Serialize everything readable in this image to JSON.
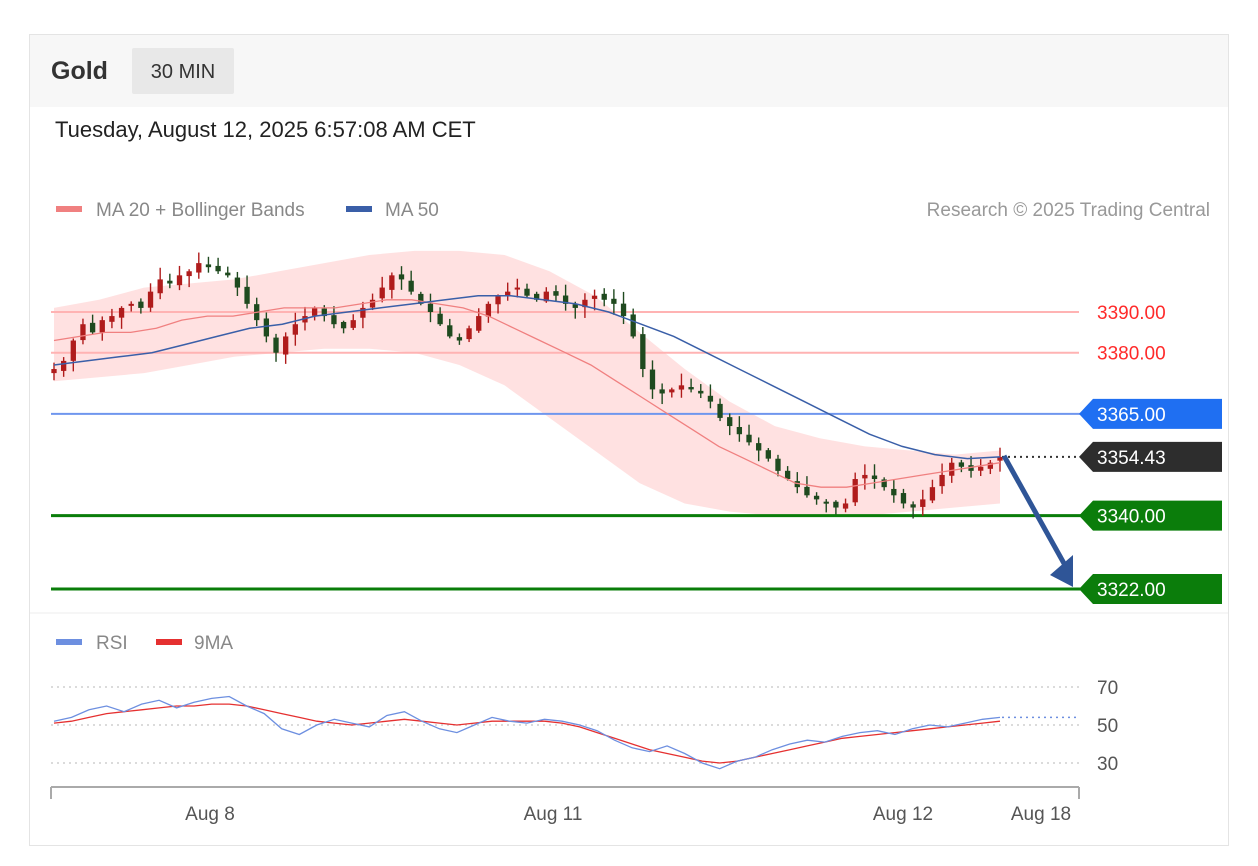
{
  "header": {
    "instrument": "Gold",
    "timeframe": "30 MIN"
  },
  "datetime": "Tuesday, August 12, 2025 6:57:08 AM CET",
  "legend": {
    "ma20": "MA 20 + Bollinger Bands",
    "ma50": "MA 50",
    "rsi": "RSI",
    "rsi_ma": "9MA"
  },
  "credit": "Research © 2025 Trading Central",
  "colors": {
    "resistance": "#ff2a2a",
    "pivot": "#2e6fe8",
    "support": "#0a7d0a",
    "last": "#333333",
    "ma20": "#f08080",
    "ma50": "#3a5fa8",
    "bands": "#ffdcdc",
    "up": "#b01c1c",
    "down": "#1f4a1f",
    "rsi": "#6d8fe0",
    "rsi_ma": "#e53030"
  },
  "chart_data": [
    {
      "type": "candlestick",
      "title": "Gold 30 MIN",
      "x_ticks": [
        "Aug 8",
        "Aug 11",
        "Aug 12",
        "Aug 18"
      ],
      "ylim": [
        3318,
        3413
      ],
      "levels": [
        {
          "label": "3390.00",
          "value": 3390.0,
          "kind": "resistance"
        },
        {
          "label": "3380.00",
          "value": 3380.0,
          "kind": "resistance"
        },
        {
          "label": "3365.00",
          "value": 3365.0,
          "kind": "pivot"
        },
        {
          "label": "3354.43",
          "value": 3354.43,
          "kind": "last"
        },
        {
          "label": "3340.00",
          "value": 3340.0,
          "kind": "support"
        },
        {
          "label": "3322.00",
          "value": 3322.0,
          "kind": "support"
        }
      ],
      "forecast": {
        "from": 3354.43,
        "to": 3322.0,
        "direction": "down"
      },
      "close_path": [
        3376,
        3378,
        3383,
        3387,
        3385,
        3388,
        3389,
        3391,
        3392,
        3391,
        3395,
        3398,
        3397,
        3399,
        3400,
        3402,
        3401,
        3400,
        3399,
        3396,
        3392,
        3388,
        3384,
        3380,
        3384,
        3387,
        3389,
        3391,
        3389,
        3387,
        3386,
        3388,
        3391,
        3393,
        3396,
        3399,
        3398,
        3395,
        3392,
        3390,
        3387,
        3384,
        3383,
        3386,
        3389,
        3392,
        3394,
        3395,
        3396,
        3394,
        3393,
        3395,
        3394,
        3392,
        3391,
        3393,
        3394,
        3393,
        3392,
        3389,
        3384,
        3376,
        3371,
        3370,
        3371,
        3372,
        3371,
        3370,
        3368,
        3364,
        3362,
        3360,
        3358,
        3356,
        3354,
        3351,
        3349,
        3347,
        3345,
        3344,
        3343,
        3342,
        3343,
        3349,
        3350,
        3349,
        3347,
        3345,
        3343,
        3342,
        3344,
        3347,
        3350,
        3353,
        3352,
        3351,
        3352,
        3353,
        3354.43
      ],
      "ma20": [
        3383,
        3384,
        3385,
        3385,
        3386,
        3388,
        3389,
        3389,
        3390,
        3391,
        3391,
        3391,
        3392,
        3393,
        3393,
        3392,
        3391,
        3389,
        3386,
        3383,
        3380,
        3377,
        3373,
        3369,
        3365,
        3361,
        3357,
        3354,
        3351,
        3348,
        3347,
        3347,
        3348,
        3349,
        3350,
        3351,
        3352,
        3353
      ],
      "ma50": [
        3377,
        3378,
        3379,
        3380,
        3382,
        3384,
        3386,
        3387,
        3389,
        3390,
        3391,
        3392,
        3393,
        3394,
        3394,
        3393,
        3392,
        3390,
        3387,
        3384,
        3380,
        3376,
        3372,
        3368,
        3364,
        3360,
        3357,
        3355,
        3354,
        3354.43
      ],
      "bands_upper": [
        3391,
        3393,
        3396,
        3397,
        3398,
        3400,
        3402,
        3404,
        3405,
        3405,
        3404,
        3400,
        3394,
        3385,
        3376,
        3368,
        3362,
        3359,
        3357,
        3356,
        3355,
        3356
      ],
      "bands_lower": [
        3373,
        3374,
        3375,
        3377,
        3379,
        3380,
        3381,
        3381,
        3380,
        3377,
        3372,
        3364,
        3356,
        3348,
        3343,
        3341,
        3340,
        3340,
        3340,
        3341,
        3342,
        3343
      ]
    },
    {
      "type": "line",
      "title": "RSI",
      "yticks": [
        "70",
        "50",
        "30"
      ],
      "ylim": [
        20,
        80
      ],
      "series": [
        {
          "name": "RSI",
          "values": [
            52,
            54,
            58,
            60,
            57,
            61,
            63,
            59,
            62,
            64,
            65,
            60,
            56,
            48,
            45,
            50,
            53,
            51,
            49,
            55,
            57,
            52,
            48,
            46,
            50,
            54,
            52,
            51,
            53,
            52,
            50,
            47,
            42,
            38,
            36,
            39,
            35,
            30,
            27,
            31,
            33,
            37,
            40,
            42,
            41,
            44,
            46,
            47,
            45,
            48,
            50,
            49,
            51,
            53,
            54
          ]
        },
        {
          "name": "9MA",
          "values": [
            51,
            52,
            54,
            56,
            57,
            58,
            59,
            60,
            60,
            61,
            61,
            60,
            58,
            56,
            54,
            52,
            51,
            50,
            51,
            52,
            53,
            52,
            51,
            50,
            51,
            52,
            52,
            52,
            52,
            51,
            49,
            46,
            43,
            40,
            37,
            35,
            33,
            31,
            30,
            31,
            33,
            35,
            37,
            39,
            41,
            43,
            44,
            45,
            46,
            47,
            48,
            49,
            50,
            51,
            52
          ]
        }
      ],
      "last_value": 54
    }
  ]
}
